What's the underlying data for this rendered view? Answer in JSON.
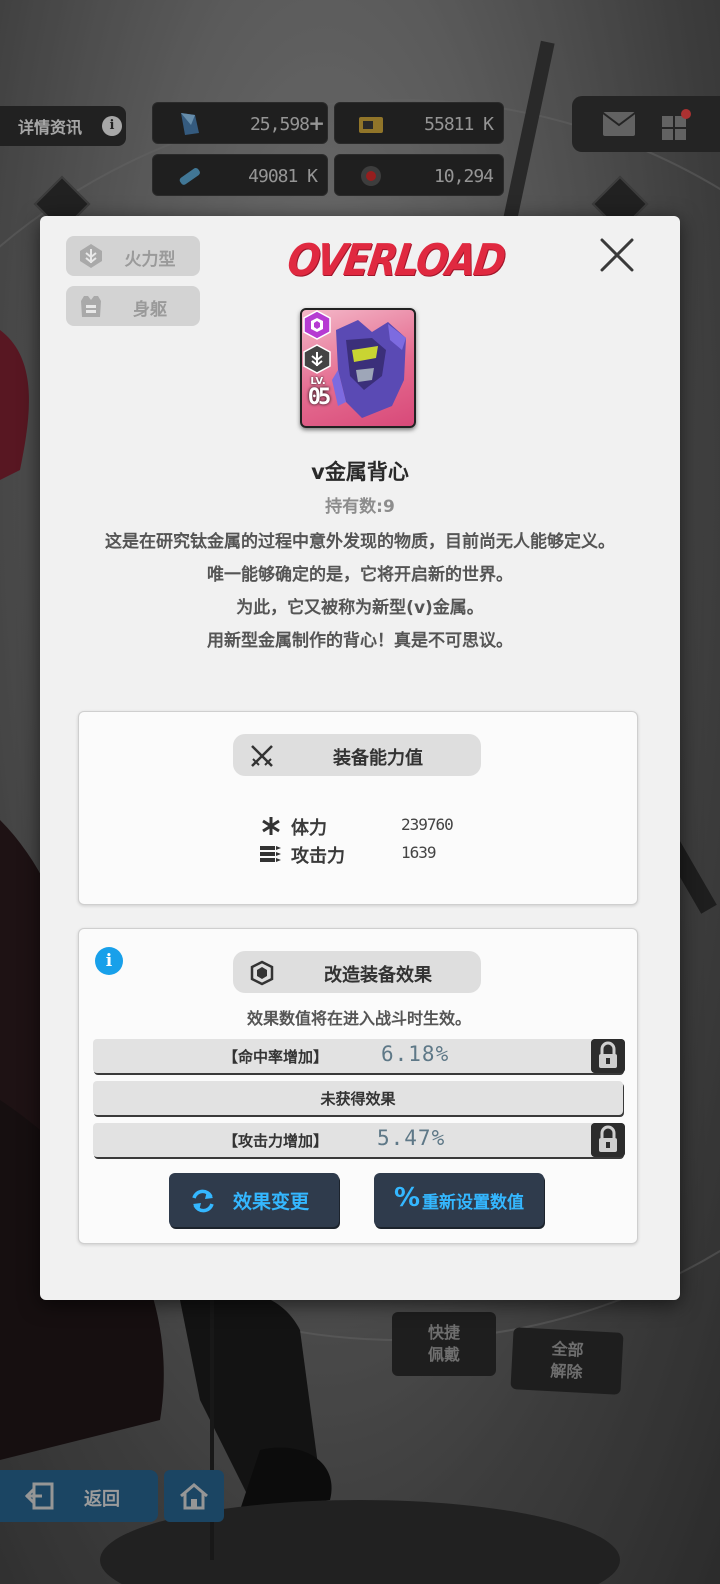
{
  "hud": {
    "info_label": "详情资讯",
    "info_icon": "info-icon",
    "resources": [
      {
        "name": "gem",
        "value": "25,598"
      },
      {
        "name": "credit",
        "value": "55811 K"
      },
      {
        "name": "core-dust",
        "value": "49081 K"
      },
      {
        "name": "battle-data",
        "value": "10,294"
      }
    ]
  },
  "bottom": {
    "quick_equip": "快捷\n佩戴",
    "unequip_all": "全部\n解除",
    "back_label": "返回"
  },
  "modal": {
    "type_chips": [
      {
        "label": "火力型",
        "icon": "firepower-icon"
      },
      {
        "label": "身躯",
        "icon": "body-armor-icon"
      }
    ],
    "logo_text": "OVERLOAD",
    "item": {
      "name": "v金属背心",
      "count_text": "持有数:9",
      "level_label": "LV.",
      "level_value": "05",
      "description": "这是在研究钛金属的过程中意外发现的物质，目前尚无人能够定义。\n唯一能够确定的是，它将开启新的世界。\n为此，它又被称为新型(v)金属。\n用新型金属制作的背心！真是不可思议。"
    },
    "stats_panel": {
      "title": "装备能力值",
      "stats": [
        {
          "label": "体力",
          "value": "239760",
          "icon": "asterisk-icon"
        },
        {
          "label": "攻击力",
          "value": "1639",
          "icon": "bullets-icon"
        }
      ]
    },
    "effects_panel": {
      "title": "改造装备效果",
      "note": "效果数值将在进入战斗时生效。",
      "rows": [
        {
          "label": "【命中率增加】",
          "value": "6.18%",
          "locked": true
        },
        {
          "label": "未获得效果",
          "value": "",
          "locked": false
        },
        {
          "label": "【攻击力增加】",
          "value": "5.47%",
          "locked": true
        }
      ],
      "change_button": "效果变更",
      "reset_button": "重新设置数值"
    }
  },
  "colors": {
    "accent_blue": "#34b7ff",
    "logo_red": "#e02940",
    "info_blue": "#18a0ea"
  }
}
